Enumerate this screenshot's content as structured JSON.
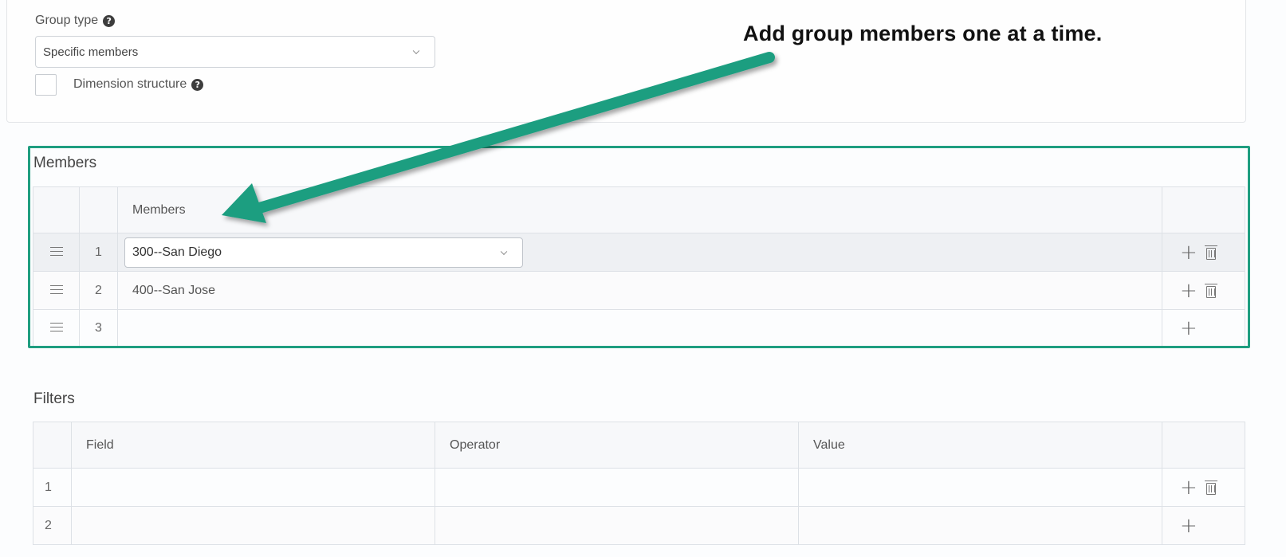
{
  "group_type": {
    "label": "Group type",
    "help_icon": "question-circle-icon",
    "selected": "Specific members"
  },
  "dimension_structure": {
    "label": "Dimension structure",
    "checked": false
  },
  "annotation": {
    "text": "Add group members one at a time.",
    "arrow_color": "#1f9e80"
  },
  "members": {
    "title": "Members",
    "column_header": "Members",
    "rows": [
      {
        "num": "1",
        "value": "300--San Diego",
        "editing": true,
        "has_delete": true
      },
      {
        "num": "2",
        "value": "400--San Jose",
        "editing": false,
        "has_delete": true
      },
      {
        "num": "3",
        "value": "",
        "editing": false,
        "has_delete": false
      }
    ]
  },
  "filters": {
    "title": "Filters",
    "columns": [
      "Field",
      "Operator",
      "Value"
    ],
    "rows": [
      {
        "num": "1",
        "has_delete": true
      },
      {
        "num": "2",
        "has_delete": false
      }
    ]
  },
  "colors": {
    "highlight_border": "#1f9e80",
    "grid_border": "#dde1e6"
  }
}
